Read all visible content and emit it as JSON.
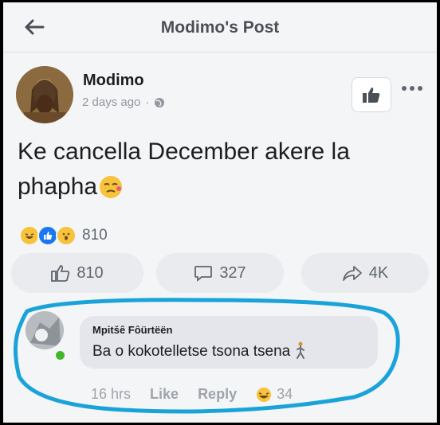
{
  "header": {
    "title": "Modimo's Post"
  },
  "post": {
    "author": "Modimo",
    "time": "2 days ago",
    "text": "Ke cancella December akere la phapha",
    "reaction_count": "810"
  },
  "actions": {
    "like": "810",
    "comment": "327",
    "share": "4K"
  },
  "comment": {
    "author": "Mpitšê Fôürtëën",
    "text": "Ba o kokotelletse tsona tsena",
    "time": "16 hrs",
    "like_label": "Like",
    "reply_label": "Reply",
    "reaction_count": "34"
  },
  "colors": {
    "highlight": "#1aa3d9",
    "online": "#42b72a",
    "like_blue": "#1877f2"
  },
  "icons": [
    "back-arrow-icon",
    "globe-icon",
    "thumbs-up-icon",
    "more-icon",
    "laugh-emoji",
    "like-reaction",
    "wow-emoji",
    "comment-icon",
    "share-icon"
  ]
}
